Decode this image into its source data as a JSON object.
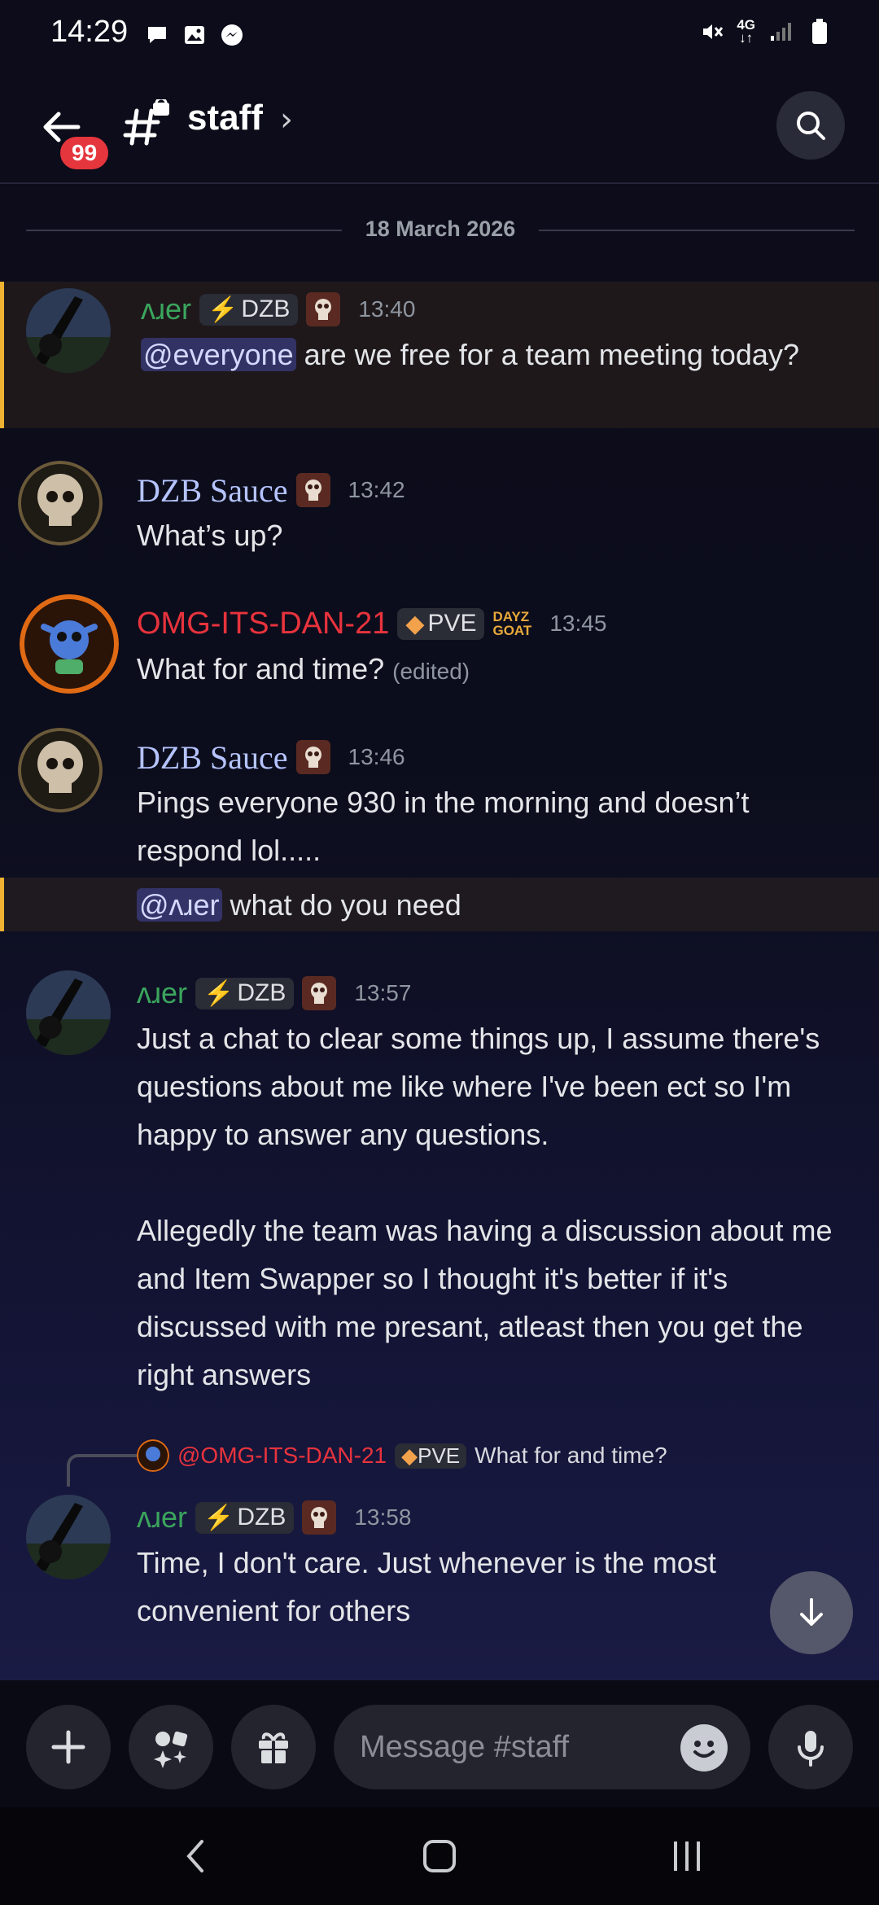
{
  "status": {
    "time": "14:29",
    "network_top": "4G",
    "network_bottom": "↓↑"
  },
  "header": {
    "badge": "99",
    "channel_name": "staff",
    "chevron": "›"
  },
  "date_divider": "18 March 2026",
  "messages": [
    {
      "username": "ʌɹer",
      "tag": "DZB",
      "time": "13:40",
      "mention": "@everyone",
      "text": " are we free for a team meeting today?"
    },
    {
      "username": "DZB Sauce",
      "time": "13:42",
      "text": "What’s up?"
    },
    {
      "username": "OMG-ITS-DAN-21",
      "tag": "PVE",
      "role_text_top": "DAYZ",
      "role_text_bottom": "GOAT",
      "time": "13:45",
      "text": "What for and time?",
      "edited": "(edited)"
    },
    {
      "username": "DZB Sauce",
      "time": "13:46",
      "text": "Pings everyone 930 in the morning and doesn’t respond lol.....",
      "followup_mention": "@ʌɹer",
      "followup_text": " what do you need"
    },
    {
      "username": "ʌɹer",
      "tag": "DZB",
      "time": "13:57",
      "line1": "Just a chat to clear some things up, I assume there's questions about me like where I've been ect so I'm happy to answer any questions.",
      "line2": "Allegedly the team was having a discussion about me and Item Swapper so I thought it's better if it's discussed with me presant, atleast then you get the right answers"
    },
    {
      "username": "ʌɹer",
      "tag": "DZB",
      "time": "13:58",
      "text": "Time, I don't care. Just whenever is the most convenient for others"
    }
  ],
  "reply": {
    "name": "@OMG-ITS-DAN-21",
    "tag": "PVE",
    "text": "What for and time?"
  },
  "composer": {
    "placeholder": "Message #staff"
  },
  "colors": {
    "aver": "#3ba55d",
    "sauce": "#b5c4ff",
    "dan": "#e8333d",
    "highlight_bar": "#f0b232"
  }
}
